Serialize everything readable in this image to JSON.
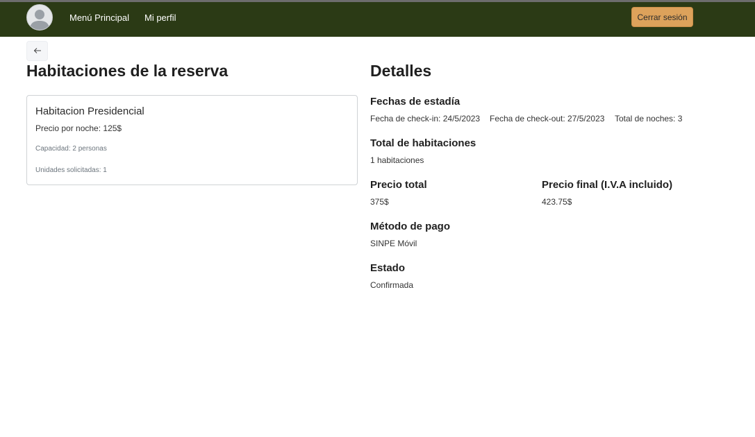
{
  "nav": {
    "menu_label": "Menú Principal",
    "profile_label": "Mi perfil",
    "logout_label": "Cerrar sesión",
    "avatar_icon": "user-avatar-icon",
    "back_icon": "arrow-left-icon"
  },
  "left": {
    "heading": "Habitaciones de la reserva",
    "rooms": [
      {
        "name": "Habitacion Presidencial",
        "price": "Precio por noche: 125$",
        "capacity": "Capacidad: 2 personas",
        "units": "Unidades solicitadas: 1"
      }
    ]
  },
  "details": {
    "heading": "Detalles",
    "dates_title": "Fechas de estadía",
    "checkin": "Fecha de check-in: 24/5/2023",
    "checkout": "Fecha de check-out: 27/5/2023",
    "nights": "Total de noches: 3",
    "rooms_title": "Total de habitaciones",
    "rooms_value": "1 habitaciones",
    "total_title": "Precio total",
    "total_value": "375$",
    "final_title": "Precio final (I.V.A incluido)",
    "final_value": "423.75$",
    "payment_title": "Método de pago",
    "payment_value": "SINPE Móvil",
    "status_title": "Estado",
    "status_value": "Confirmada"
  },
  "colors": {
    "navbar": "#2b3a15",
    "logout_button": "#dda25b"
  }
}
